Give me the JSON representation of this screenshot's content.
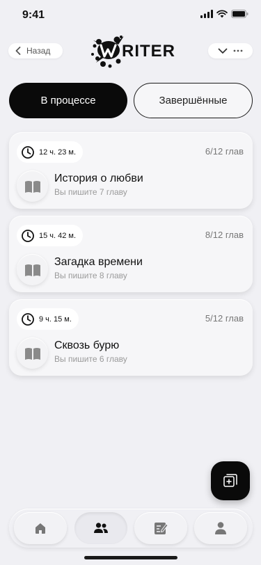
{
  "status_bar": {
    "time": "9:41"
  },
  "header": {
    "back_label": "Назад",
    "logo_text": "WRITER"
  },
  "tabs": [
    {
      "label": "В процессе",
      "active": true
    },
    {
      "label": "Завершённые",
      "active": false
    }
  ],
  "stories": [
    {
      "timer": "12 ч. 23 м.",
      "chapters": "6/12 глав",
      "title": "История о любви",
      "subtitle": "Вы пишите 7 главу"
    },
    {
      "timer": "15 ч. 42 м.",
      "chapters": "8/12 глав",
      "title": "Загадка времени",
      "subtitle": "Вы пишите 8 главу"
    },
    {
      "timer": "9 ч. 15 м.",
      "chapters": "5/12 глав",
      "title": "Сквозь бурю",
      "subtitle": "Вы пишите 6 главу"
    }
  ],
  "fab": {
    "icon": "add-note-icon"
  },
  "bottom_nav": [
    {
      "icon": "home-icon",
      "active": false
    },
    {
      "icon": "users-icon",
      "active": true
    },
    {
      "icon": "edit-icon",
      "active": false
    },
    {
      "icon": "profile-icon",
      "active": false
    }
  ],
  "colors": {
    "background": "#f0f0f4",
    "accent": "#0a0a0a",
    "muted": "#9a9a9a"
  }
}
